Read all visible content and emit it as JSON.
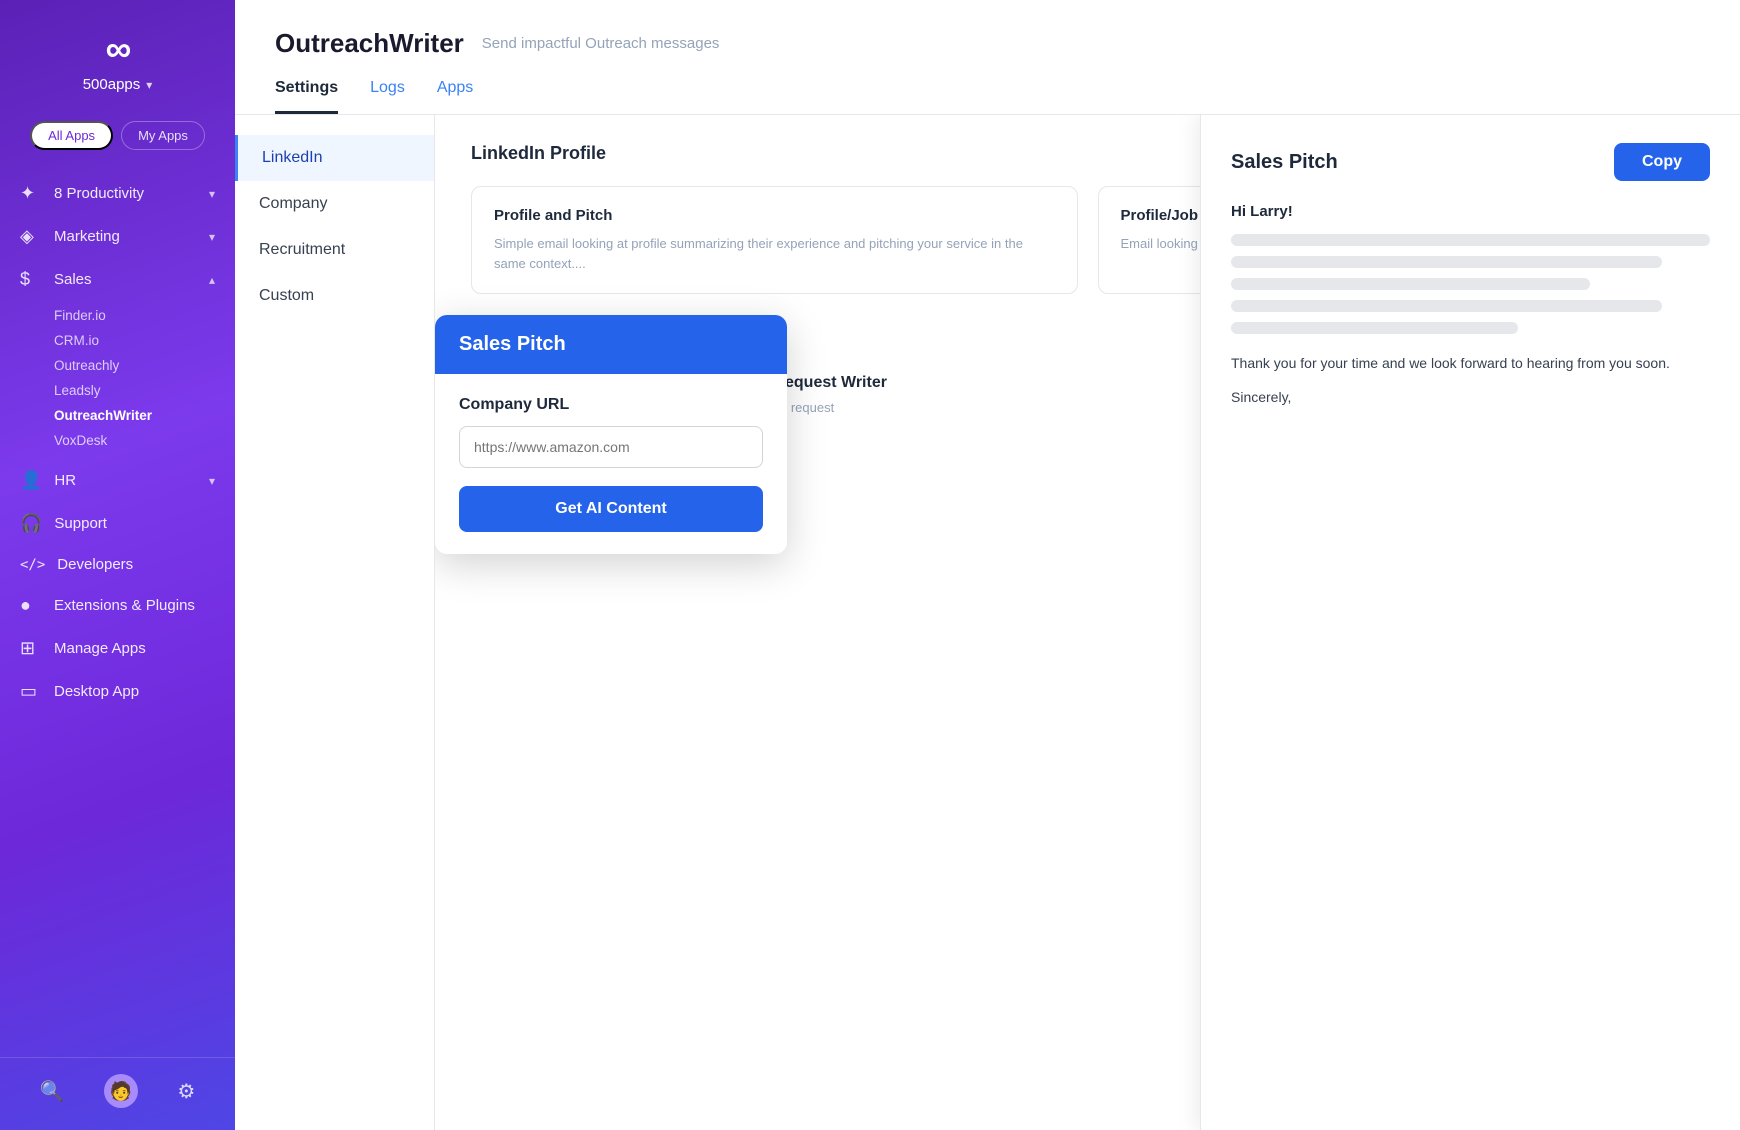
{
  "sidebar": {
    "logo_text": "∞",
    "brand": "500apps",
    "brand_chevron": "▾",
    "tabs": [
      {
        "label": "All Apps",
        "active": true
      },
      {
        "label": "My Apps",
        "active": false
      }
    ],
    "nav_items": [
      {
        "id": "productivity",
        "icon": "✦",
        "label": "Productivity",
        "has_chevron": true,
        "open": false,
        "badge": "8"
      },
      {
        "id": "marketing",
        "icon": "◈",
        "label": "Marketing",
        "has_chevron": true
      },
      {
        "id": "sales",
        "icon": "$",
        "label": "Sales",
        "has_chevron": true,
        "open": true
      }
    ],
    "sales_subitems": [
      {
        "label": "Finder.io",
        "active": false
      },
      {
        "label": "CRM.io",
        "active": false
      },
      {
        "label": "Outreachly",
        "active": false
      },
      {
        "label": "Leadsly",
        "active": false
      },
      {
        "label": "OutreachWriter",
        "active": true
      },
      {
        "label": "VoxDesk",
        "active": false
      }
    ],
    "bottom_nav": [
      {
        "id": "hr",
        "icon": "👤",
        "label": "HR",
        "has_chevron": true
      },
      {
        "id": "support",
        "icon": "🎧",
        "label": "Support",
        "has_chevron": false
      },
      {
        "id": "developers",
        "icon": "<>",
        "label": "Developers",
        "has_chevron": false
      },
      {
        "id": "extensions",
        "icon": "●",
        "label": "Extensions & Plugins",
        "has_chevron": false
      },
      {
        "id": "manage",
        "icon": "⊞",
        "label": "Manage Apps",
        "has_chevron": false
      },
      {
        "id": "desktop",
        "icon": "▭",
        "label": "Desktop App",
        "has_chevron": false
      }
    ],
    "bottom_icons": [
      "🔍",
      "👤",
      "⚙"
    ]
  },
  "header": {
    "title": "OutreachWriter",
    "subtitle": "Send impactful Outreach messages",
    "tabs": [
      {
        "label": "Settings",
        "active": true
      },
      {
        "label": "Logs",
        "active": false,
        "blue": true
      },
      {
        "label": "Apps",
        "active": false,
        "blue": true
      }
    ]
  },
  "settings_nav": [
    {
      "label": "LinkedIn",
      "active": true
    },
    {
      "label": "Company",
      "active": false
    },
    {
      "label": "Recruitment",
      "active": false
    },
    {
      "label": "Custom",
      "active": false
    }
  ],
  "linkedin_section": {
    "title": "LinkedIn Profile",
    "cards": [
      {
        "title": "Profile and Pitch",
        "desc": "Simple email looking at profile summarizing their experience and pitching your service in the same context...."
      },
      {
        "title": "Profile/Job Changes and Pitch",
        "desc": "Email looking at profile and job changes and pitching your service in the same...."
      }
    ]
  },
  "custom_panel": {
    "title": "Sales Pitch",
    "company_url_label": "Company URL",
    "input_placeholder": "https://www.amazon.com",
    "button_label": "Get AI Content"
  },
  "connection_section": {
    "title": "Connection Request Writer",
    "subtitle": "Simple connection request"
  },
  "sales_result": {
    "title": "Sales Pitch",
    "copy_label": "Copy",
    "greeting": "Hi Larry!",
    "footer_line1": "Thank you for your time and we look forward to hearing from you soon.",
    "footer_line2": "Sincerely,"
  }
}
